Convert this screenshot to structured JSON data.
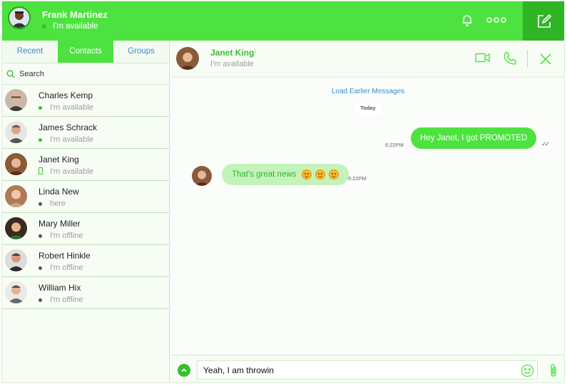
{
  "user": {
    "name": "Frank Martinez",
    "status": "I'm available"
  },
  "header": {
    "icons": [
      "bell-icon",
      "more-icon",
      "compose-icon"
    ]
  },
  "tabs": [
    {
      "label": "Recent",
      "active": false
    },
    {
      "label": "Contacts",
      "active": true
    },
    {
      "label": "Groups",
      "active": false
    }
  ],
  "search": {
    "placeholder": "Search"
  },
  "contacts": [
    {
      "name": "Charles Kemp",
      "status": "I'm available",
      "presence": "online"
    },
    {
      "name": "James Schrack",
      "status": "I'm available",
      "presence": "online"
    },
    {
      "name": "Janet King",
      "status": "I'm available",
      "presence": "mobile"
    },
    {
      "name": "Linda New",
      "status": "here",
      "presence": "offline"
    },
    {
      "name": "Mary Miller",
      "status": "I'm offline",
      "presence": "offline"
    },
    {
      "name": "Robert Hinkle",
      "status": "I'm offline",
      "presence": "offline"
    },
    {
      "name": "William Hix",
      "status": "I'm offline",
      "presence": "offline"
    }
  ],
  "chat": {
    "name": "Janet King",
    "status": "I'm available",
    "load_earlier": "Load Earlier Messages",
    "day_label": "Today",
    "messages": [
      {
        "direction": "out",
        "text": "Hey Janet, I got PROMOTED",
        "time": "6:22PM"
      },
      {
        "direction": "in",
        "text": "That's great news",
        "time": "6:22PM"
      }
    ],
    "composer_value": "Yeah, I am throwin"
  },
  "colors": {
    "accent": "#4ee241",
    "accent_dark": "#2fb526",
    "link": "#3b8bd2",
    "bubble_in": "#c4f2bb"
  }
}
